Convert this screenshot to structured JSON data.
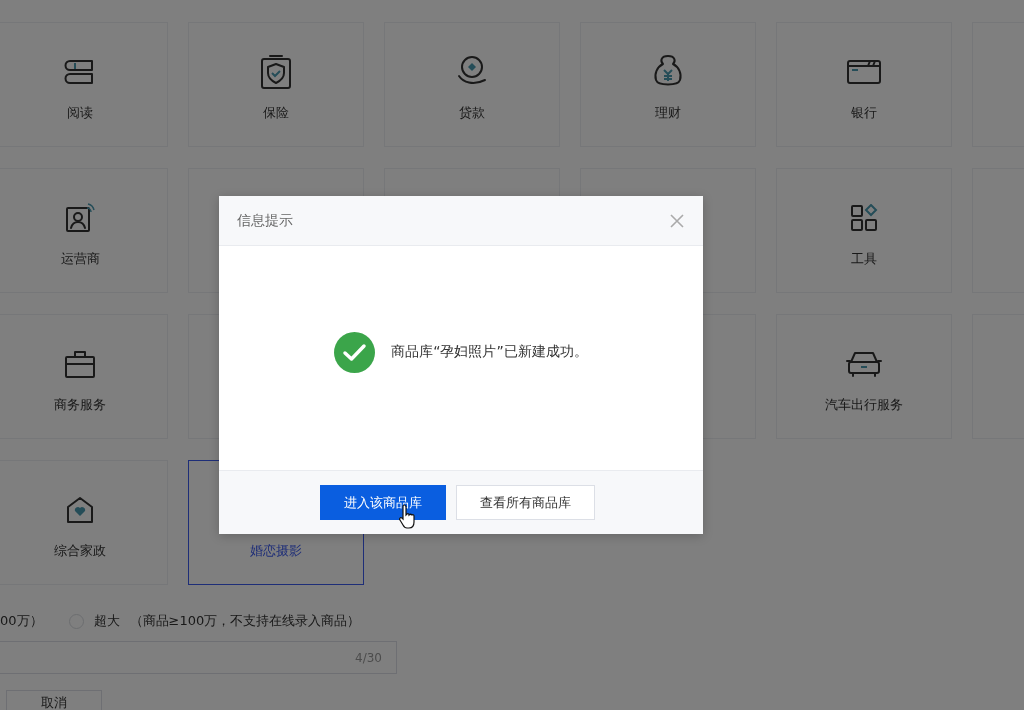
{
  "categories": [
    {
      "kind": "category",
      "label": "阅读",
      "selected": false
    },
    {
      "kind": "category",
      "label": "保险",
      "selected": false
    },
    {
      "kind": "category",
      "label": "贷款",
      "selected": false
    },
    {
      "kind": "category",
      "label": "理财",
      "selected": false
    },
    {
      "kind": "category",
      "label": "银行",
      "selected": false
    },
    {
      "kind": "blank"
    },
    {
      "kind": "category",
      "label": "运营商",
      "selected": false
    },
    {
      "kind": "blank"
    },
    {
      "kind": "blank"
    },
    {
      "kind": "blank"
    },
    {
      "kind": "category",
      "label": "工具",
      "selected": false
    },
    {
      "kind": "blank"
    },
    {
      "kind": "category",
      "label": "商务服务",
      "selected": false
    },
    {
      "kind": "blank"
    },
    {
      "kind": "gap"
    },
    {
      "kind": "blank"
    },
    {
      "kind": "category",
      "label": "汽车出行服务",
      "selected": false
    },
    {
      "kind": "blank"
    },
    {
      "kind": "category",
      "label": "综合家政",
      "selected": false
    },
    {
      "kind": "category",
      "label": "婚恋摄影",
      "selected": true
    }
  ],
  "size_options": [
    {
      "label": "00万）",
      "kind": "cut"
    },
    {
      "label": "超大",
      "note": "（商品≥100万，不支持在线录入商品）",
      "selected": false,
      "kind": "radio"
    }
  ],
  "name_field": {
    "counter": "4/30"
  },
  "cancel_button": "取消",
  "dialog": {
    "title": "信息提示",
    "message": "商品库“孕妇照片”已新建成功。",
    "buttons": [
      {
        "label": "进入该商品库",
        "kind": "primary"
      },
      {
        "label": "查看所有商品库",
        "kind": "secondary"
      }
    ]
  }
}
